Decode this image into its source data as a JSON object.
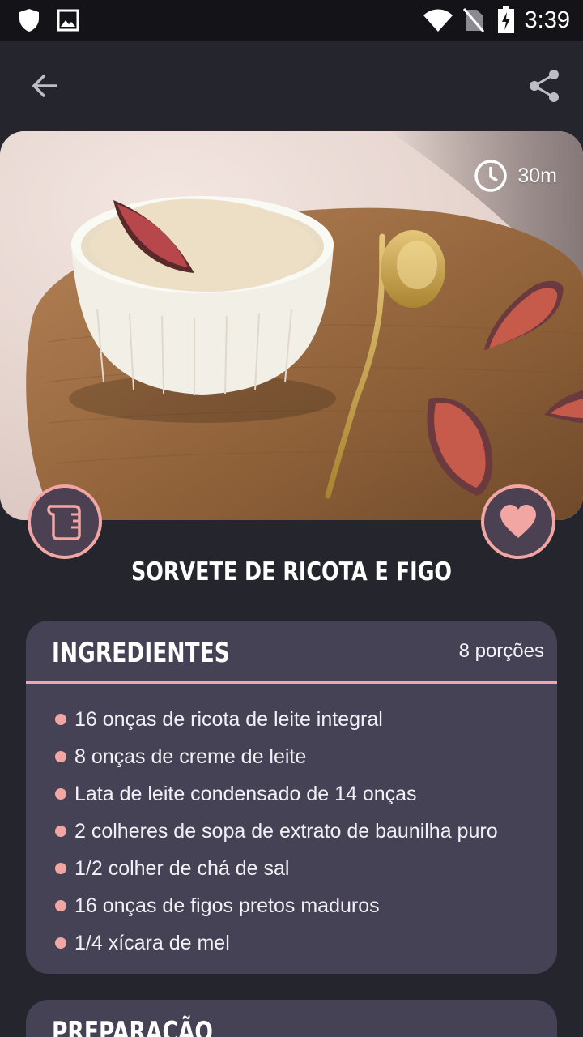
{
  "status_bar": {
    "time": "3:39"
  },
  "app_bar": {
    "back_icon": "arrow-left-icon",
    "share_icon": "share-icon"
  },
  "recipe": {
    "title": "SORVETE DE RICOTA E FIGO",
    "time": "30m",
    "favorite_icon": "heart-icon",
    "measure_icon": "measuring-cup-icon"
  },
  "ingredients": {
    "title": "INGREDIENTES",
    "servings": "8 porções",
    "items": [
      "16 onças de ricota de leite integral",
      "8 onças de creme de leite",
      "Lata de leite condensado de 14 onças",
      "2 colheres de sopa de extrato de baunilha puro",
      "1/2 colher de chá de sal",
      "16 onças de figos pretos maduros",
      "1/4 xícara de mel"
    ]
  },
  "preparation": {
    "title": "PREPARAÇÃO"
  },
  "colors": {
    "background": "#25252d",
    "card": "#454255",
    "accent": "#f1a6a4",
    "status_bar": "#141418"
  }
}
